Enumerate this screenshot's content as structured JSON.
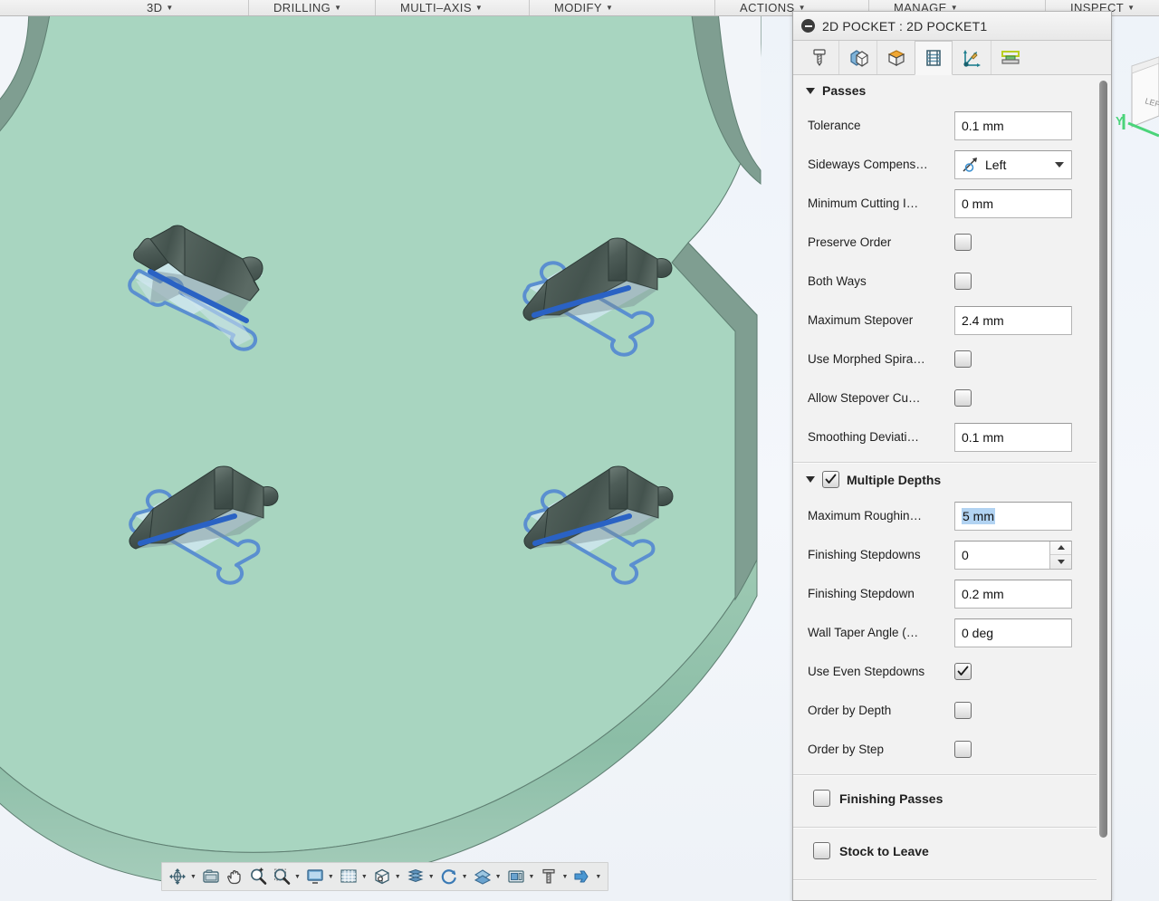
{
  "ribbon": {
    "items": [
      {
        "label": "3D",
        "caret": "▼"
      },
      {
        "label": "DRILLING",
        "caret": "▼"
      },
      {
        "label": "MULTI–AXIS",
        "caret": "▼"
      },
      {
        "label": "MODIFY",
        "caret": "▼"
      },
      {
        "label": "ACTIONS",
        "caret": "▼"
      },
      {
        "label": "MANAGE",
        "caret": "▼"
      },
      {
        "label": "INSPECT",
        "caret": "▼"
      }
    ]
  },
  "viewcube": {
    "face_label": "LEFT",
    "axis_label": "Y",
    "axis_color": "#4bd47a"
  },
  "canvas": {
    "background_color": "#eef3f9",
    "part_top_color": "#a8d5c0",
    "part_side_color": "#8fbda8",
    "pocket_fill_color": "#cfe6ef",
    "pocket_outline_color": "#5b8fd0",
    "toolpath_color": "#2a62c4",
    "wall_color": "#4a5a55",
    "pocket_count": 4
  },
  "navbar": {
    "buttons": [
      {
        "name": "orbit",
        "has_caret": true
      },
      {
        "name": "look-at",
        "has_caret": false
      },
      {
        "name": "pan",
        "has_caret": false
      },
      {
        "name": "zoom",
        "has_caret": false
      },
      {
        "name": "zoom-window",
        "has_caret": true
      },
      {
        "name": "display-settings",
        "has_caret": true
      },
      {
        "name": "grid-and-snaps",
        "has_caret": true
      },
      {
        "name": "viewports",
        "has_caret": true
      },
      {
        "name": "visual-style",
        "has_caret": true
      },
      {
        "name": "refresh-toolpath",
        "has_caret": true
      },
      {
        "name": "layers",
        "has_caret": true
      },
      {
        "name": "machine",
        "has_caret": true
      },
      {
        "name": "tool-library",
        "has_caret": true
      },
      {
        "name": "simulate",
        "has_caret": true
      }
    ]
  },
  "dialog": {
    "title": "2D POCKET : 2D POCKET1",
    "tabs": [
      {
        "name": "tool",
        "active": false
      },
      {
        "name": "geometry",
        "active": false
      },
      {
        "name": "heights",
        "active": false
      },
      {
        "name": "passes",
        "active": true
      },
      {
        "name": "linking",
        "active": false
      },
      {
        "name": "stock",
        "active": false
      }
    ],
    "sections": [
      {
        "id": "passes",
        "title": "Passes",
        "expanded": true,
        "has_checkbox": false,
        "rows": [
          {
            "label": "Tolerance",
            "type": "text",
            "value": "0.1 mm"
          },
          {
            "label": "Sideways Compens…",
            "type": "combo",
            "value": "Left",
            "icon": "sideways-compensation-left-icon"
          },
          {
            "label": "Minimum Cutting I…",
            "type": "text",
            "value": "0 mm"
          },
          {
            "label": "Preserve Order",
            "type": "checkbox",
            "checked": false
          },
          {
            "label": "Both Ways",
            "type": "checkbox",
            "checked": false
          },
          {
            "label": "Maximum Stepover",
            "type": "text",
            "value": "2.4 mm"
          },
          {
            "label": "Use Morphed Spira…",
            "type": "checkbox",
            "checked": false
          },
          {
            "label": "Allow Stepover Cu…",
            "type": "checkbox",
            "checked": false
          },
          {
            "label": "Smoothing Deviati…",
            "type": "text",
            "value": "0.1 mm"
          }
        ]
      },
      {
        "id": "multiple-depths",
        "title": "Multiple Depths",
        "expanded": true,
        "has_checkbox": true,
        "checked": true,
        "rows": [
          {
            "label": "Maximum Roughin…",
            "type": "text",
            "value": "5 mm",
            "selected": true
          },
          {
            "label": "Finishing Stepdowns",
            "type": "spinner",
            "value": "0"
          },
          {
            "label": "Finishing Stepdown",
            "type": "text",
            "value": "0.2 mm"
          },
          {
            "label": "Wall Taper Angle (…",
            "type": "text",
            "value": "0 deg"
          },
          {
            "label": "Use Even Stepdowns",
            "type": "checkbox",
            "checked": true
          },
          {
            "label": "Order by Depth",
            "type": "checkbox",
            "checked": false
          },
          {
            "label": "Order by Step",
            "type": "checkbox",
            "checked": false
          }
        ]
      },
      {
        "id": "finishing-passes",
        "title": "Finishing Passes",
        "expanded": false,
        "has_checkbox": true,
        "checked": false,
        "rows": []
      },
      {
        "id": "stock-to-leave",
        "title": "Stock to Leave",
        "expanded": false,
        "has_checkbox": true,
        "checked": false,
        "rows": []
      }
    ],
    "selection_highlight_color": "#b2d3f2"
  }
}
